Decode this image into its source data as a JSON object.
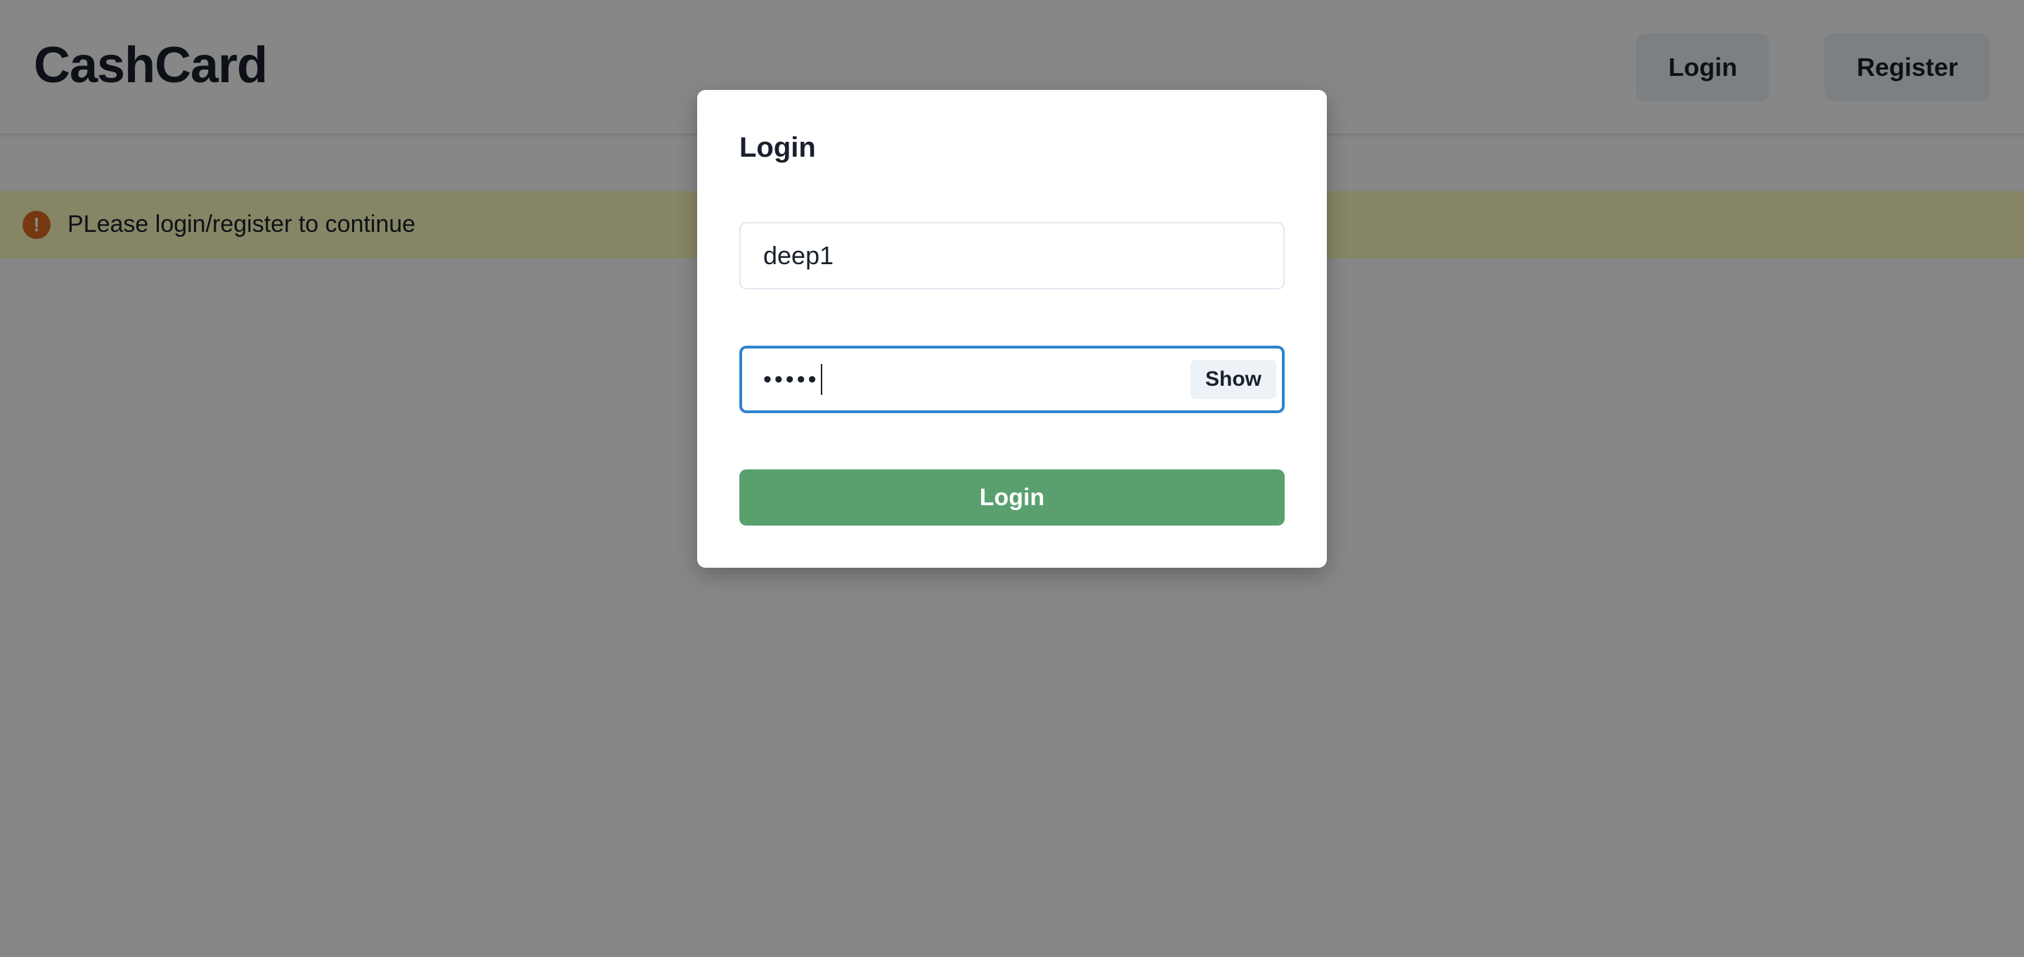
{
  "header": {
    "brand": "CashCard",
    "login_label": "Login",
    "register_label": "Register"
  },
  "alert": {
    "icon": "warning-circle-icon",
    "text": "PLease login/register to continue"
  },
  "modal": {
    "title": "Login",
    "username": {
      "value": "deep1"
    },
    "password": {
      "masked_value": "•••••",
      "toggle_label": "Show"
    },
    "submit_label": "Login"
  },
  "colors": {
    "submit_button": "#5aa06f",
    "focus_border": "#3182ce",
    "alert_background": "#fefcbf",
    "alert_icon": "#dd6b20"
  }
}
